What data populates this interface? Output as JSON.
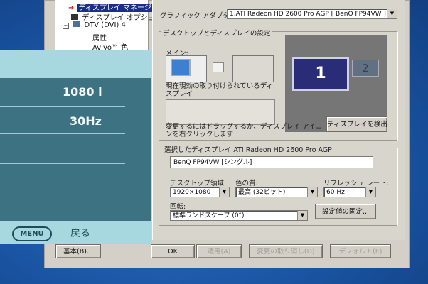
{
  "tree": {
    "items": [
      {
        "label": "ディスプレイ マネージャ",
        "selected": true
      },
      {
        "label": "ディスプレイ オプション"
      },
      {
        "label": "DTV (DVI) 4"
      },
      {
        "label": "属性"
      },
      {
        "label": "Avivo™ 色"
      }
    ]
  },
  "adapter": {
    "label": "グラフィック アダプタ:",
    "value": "1.ATI Radeon HD 2600 Pro AGP [ BenQ FP94VW ]"
  },
  "desktop_group": {
    "title": "デスクトップとディスプレイの設定",
    "main_label": "メイン:",
    "attached_label": "現在現効の取り付けられているディスプレイ",
    "drag_hint": "変更するにはドラッグするか、ディスプレイ アイコンを右クリックします",
    "detect_button": "ディスプレイを検出",
    "monitor_primary": "1",
    "monitor_secondary": "2"
  },
  "selected_group": {
    "title": "選択したディスプレイ ATI Radeon HD 2600 Pro AGP",
    "display_name": "BenQ FP94VW [シングル]",
    "resolution_label": "デスクトップ領域:",
    "resolution_value": "1920×1080",
    "color_label": "色の質:",
    "color_value": "最高 (32ビット)",
    "refresh_label": "リフレッシュ レート:",
    "refresh_value": "60 Hz",
    "rotation_label": "回転:",
    "rotation_value": "標準ランドスケープ (0°)",
    "fix_button": "設定値の固定..."
  },
  "footer": {
    "basic_button": "基本(B)...",
    "ok_button": "OK",
    "apply_button": "適用(A)",
    "discard_button": "変更の取り消し(D)",
    "default_button": "デフォルト(E)"
  },
  "osd": {
    "resolution": "1080 i",
    "frequency": "30Hz",
    "menu_label": "MENU",
    "back_label": "戻る"
  }
}
